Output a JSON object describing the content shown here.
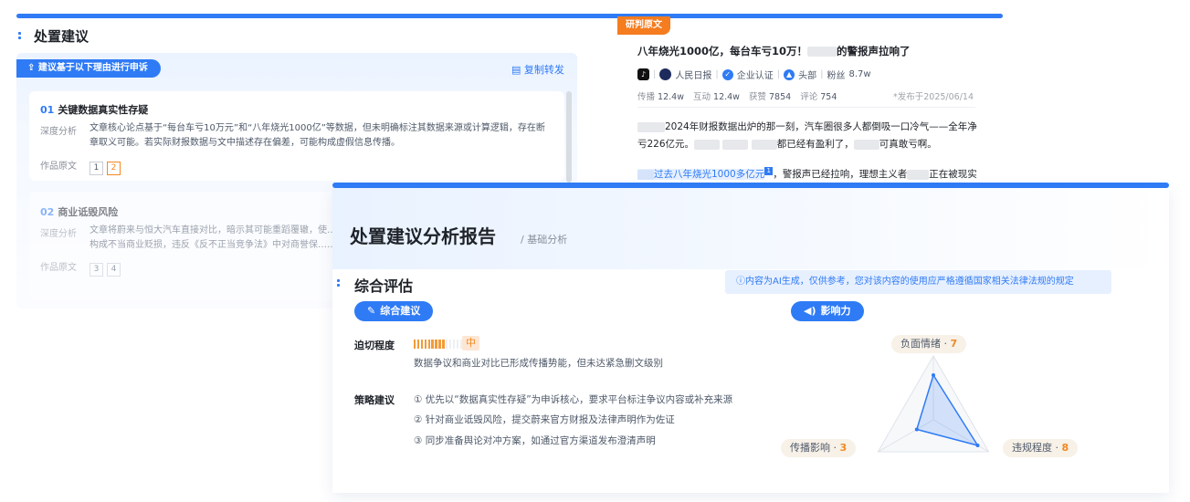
{
  "back": {
    "left_title": "处置建议",
    "reason_pill": "建议基于以下理由进行申诉",
    "copy_btn": "复制转发",
    "reason1": {
      "num": "01",
      "title": "关键数据真实性存疑",
      "label": "深度分析",
      "text": "文章核心论点基于“每台车亏10万元”和“八年烧光1000亿”等数据，但未明确标注其数据来源或计算逻辑，存在断章取义可能。若实际财报数据与文中描述存在偏差，可能构成虚假信息传播。",
      "ref_label": "作品原文",
      "refs": [
        "1",
        "2"
      ]
    },
    "reason2": {
      "num": "02",
      "title": "商业诋毁风险",
      "label": "深度分析",
      "text": "文章将蔚来与恒大汽车直接对比，暗示其可能重蹈覆辙，使……能构成不当商业贬损，违反《反不正当竞争法》中对商誉保……",
      "ref_label": "作品原文",
      "refs": [
        "3",
        "4"
      ]
    },
    "article": {
      "tag": "研判原文",
      "title_pre": "八年烧光1000亿，每台车亏10万！",
      "title_post": "的警报声拉响了",
      "platform_icon": "tiktok-icon",
      "author": "人民日报",
      "cert": "企业认证",
      "rank": "头部",
      "fans_label": "粉丝",
      "fans": "8.7w",
      "stats": [
        {
          "label": "传播",
          "value": "12.4w"
        },
        {
          "label": "互动",
          "value": "12.4w"
        },
        {
          "label": "获赞",
          "value": "7854"
        },
        {
          "label": "评论",
          "value": "754"
        }
      ],
      "publish": "*发布于2025/06/14",
      "para1_a": "2024年财报数据出炉的那一刻，汽车圈很多人都倒吸一口冷气——全年净亏226亿元。",
      "para1_b": "都已经有盈利了，",
      "para1_c": "可真敢亏啊。",
      "para2_hl": "过去八年烧光1000多亿元",
      "para2_sup": "1",
      "para2_rest": "，警报声已经拉响，理想主义者",
      "para2_end": "正在被现实"
    }
  },
  "front": {
    "title": "处置建议分析报告",
    "subtitle": "/ 基础分析",
    "section_title": "综合评估",
    "ai_note": "ⓘ内容为AI生成，仅供参考，您对该内容的使用应严格遵循国家相关法律法规的规定",
    "advice_pill": "综合建议",
    "impact_pill": "影响力",
    "urgency_label": "迫切程度",
    "urgency_level_value": 0.5,
    "urgency_level": "中",
    "urgency_desc": "数据争议和商业对比已形成传播势能，但未达紧急删文级别",
    "strategy_label": "策略建议",
    "strategies": [
      "① 优先以“数据真实性存疑”为申诉核心，要求平台标注争议内容或补充来源",
      "② 针对商业诋毁风险，提交蔚来官方财报及法律声明作为佐证",
      "③ 同步准备舆论对冲方案，如通过官方渠道发布澄清声明"
    ],
    "radar": {
      "max": 10,
      "axes": [
        {
          "name": "负面情绪",
          "score": 7
        },
        {
          "name": "违规程度",
          "score": 8
        },
        {
          "name": "传播影响",
          "score": 3
        }
      ]
    }
  }
}
